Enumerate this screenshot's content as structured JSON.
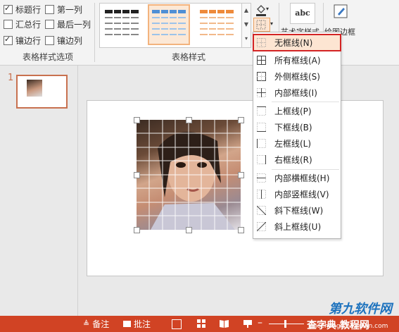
{
  "ribbon": {
    "options": {
      "header_row": "标题行",
      "first_column": "第一列",
      "total_row": "汇总行",
      "last_column": "最后一列",
      "banded_rows": "镶边行",
      "banded_columns": "镶边列",
      "group_label": "表格样式选项"
    },
    "styles_group_label": "表格样式",
    "wordart_label": "艺术字样式",
    "draw_borders_label": "绘图边框",
    "abc_icon_text": "abc"
  },
  "slide_number": "1",
  "border_menu": {
    "items": [
      {
        "label": "无框线(N)",
        "highlighted": true
      },
      {
        "label": "所有框线(A)"
      },
      {
        "label": "外侧框线(S)"
      },
      {
        "label": "内部框线(I)"
      },
      {
        "label": "上框线(P)"
      },
      {
        "label": "下框线(B)"
      },
      {
        "label": "左框线(L)"
      },
      {
        "label": "右框线(R)"
      },
      {
        "label": "内部横框线(H)"
      },
      {
        "label": "内部竖框线(V)"
      },
      {
        "label": "斜下框线(W)"
      },
      {
        "label": "斜上框线(U)"
      }
    ]
  },
  "statusbar": {
    "notes_label": "备注",
    "comments_label": "批注"
  },
  "watermark": {
    "brand": "第九软件网",
    "site_name": "查字典 教程网",
    "url": "jiaocheng.chazidian.com"
  },
  "colors": {
    "accent": "#d14324",
    "menu_highlight": "#fde5d2",
    "highlight_border": "#d32424"
  }
}
